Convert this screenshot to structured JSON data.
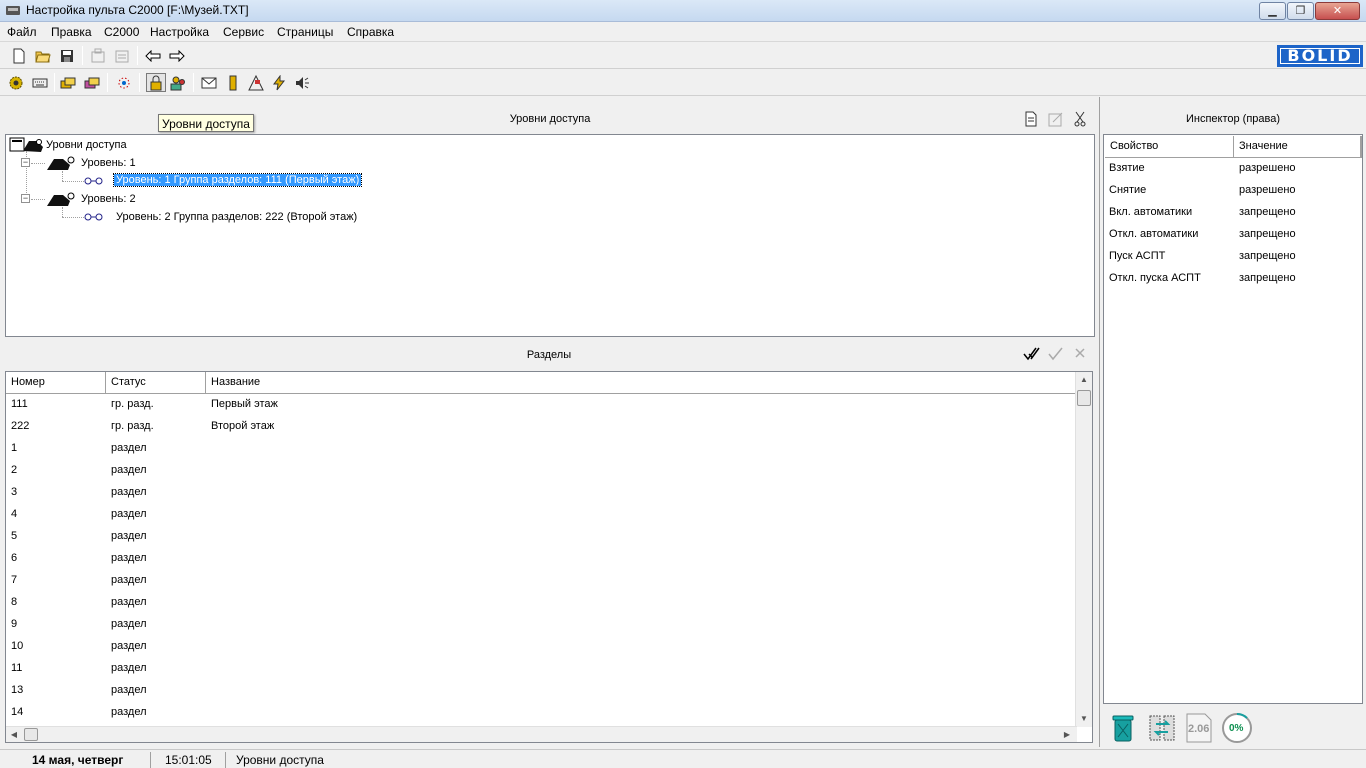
{
  "window": {
    "title": "Настройка пульта С2000 [F:\\Музей.TXT]",
    "controls": {
      "minimize": "▁",
      "maximize": "❐",
      "close": "✕"
    }
  },
  "menu": [
    "Файл",
    "Правка",
    "С2000",
    "Настройка",
    "Сервис",
    "Страницы",
    "Справка"
  ],
  "logo": "BOLID",
  "tooltip": "Уровни доступа",
  "access_panel": {
    "caption": "Уровни доступа",
    "tree": {
      "root": "Уровни доступа",
      "levels": [
        {
          "label": "Уровень: 1",
          "child": "Уровень: 1 Группа разделов: 111 (Первый этаж)",
          "selected": true
        },
        {
          "label": "Уровень: 2",
          "child": "Уровень: 2 Группа разделов: 222 (Второй этаж)",
          "selected": false
        }
      ]
    }
  },
  "sections_panel": {
    "caption": "Разделы",
    "columns": [
      "Номер",
      "Статус",
      "Название"
    ],
    "rows": [
      [
        "111",
        "гр. разд.",
        "Первый этаж"
      ],
      [
        "222",
        "гр. разд.",
        "Второй этаж"
      ],
      [
        "1",
        "раздел",
        ""
      ],
      [
        "2",
        "раздел",
        ""
      ],
      [
        "3",
        "раздел",
        ""
      ],
      [
        "4",
        "раздел",
        ""
      ],
      [
        "5",
        "раздел",
        ""
      ],
      [
        "6",
        "раздел",
        ""
      ],
      [
        "7",
        "раздел",
        ""
      ],
      [
        "8",
        "раздел",
        ""
      ],
      [
        "9",
        "раздел",
        ""
      ],
      [
        "10",
        "раздел",
        ""
      ],
      [
        "11",
        "раздел",
        ""
      ],
      [
        "13",
        "раздел",
        ""
      ],
      [
        "14",
        "раздел",
        ""
      ]
    ]
  },
  "inspector": {
    "caption": "Инспектор (права)",
    "columns": [
      "Свойство",
      "Значение"
    ],
    "rows": [
      [
        "Взятие",
        "разрешено"
      ],
      [
        "Снятие",
        "разрешено"
      ],
      [
        "Вкл. автоматики",
        "запрещено"
      ],
      [
        "Откл. автоматики",
        "запрещено"
      ],
      [
        "Пуск АСПТ",
        "запрещено"
      ],
      [
        "Откл. пуска АСПТ",
        "запрещено"
      ]
    ]
  },
  "bottom_icons": {
    "version": "2.06",
    "progress": "0%"
  },
  "statusbar": {
    "date": "14 мая, четверг",
    "time": "15:01:05",
    "page": "Уровни доступа"
  },
  "colors": {
    "selection": "#3399ff",
    "brand": "#1d64c8",
    "teal": "#17a0a0"
  }
}
